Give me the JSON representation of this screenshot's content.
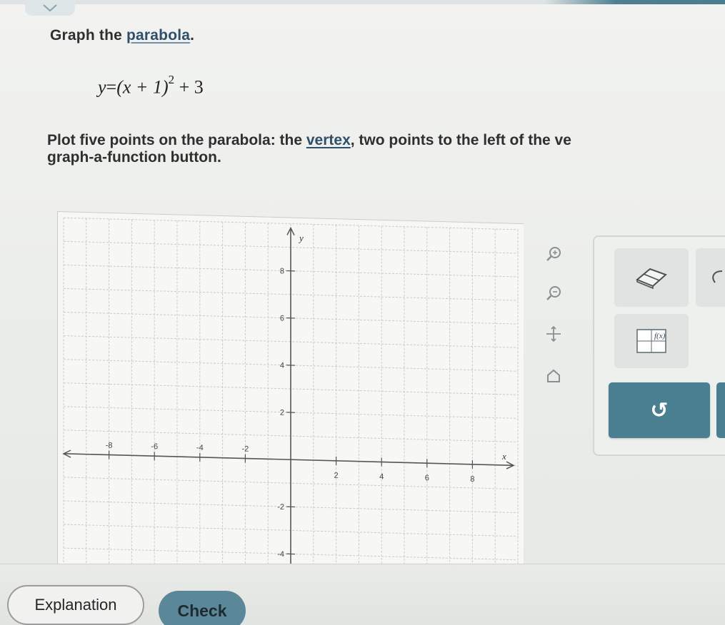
{
  "prompt": {
    "title_prefix": "Graph the ",
    "title_link": "parabola",
    "title_suffix": ".",
    "equation_lhs": "y",
    "equation_eq": "=",
    "equation_inner": "(x + 1)",
    "equation_exp": "2",
    "equation_tail": " + 3",
    "instructions_line1_prefix": "Plot five points on the parabola: the ",
    "instructions_line1_link": "vertex",
    "instructions_line1_suffix": ", two points to the left of the ve",
    "instructions_line2": "graph-a-function button."
  },
  "graph": {
    "axis_x_label": "x",
    "axis_y_label": "y",
    "x_tick_labels": [
      "-8",
      "-6",
      "-4",
      "-2",
      "2",
      "4",
      "6",
      "8"
    ],
    "y_tick_labels": [
      "8",
      "6",
      "4",
      "2",
      "-2",
      "-4"
    ],
    "x_range": [
      -10,
      10
    ],
    "y_range": [
      -6,
      10
    ],
    "grid": true,
    "grid_color": "#c9ccc7",
    "axis_color": "#555555"
  },
  "toolbar": {
    "icons": [
      "zoom-in-icon",
      "zoom-out-icon",
      "move-icon",
      "home-icon"
    ]
  },
  "tools": {
    "eraser_icon": "eraser-icon",
    "function_icon": "graph-function-icon",
    "undo_label": "↺"
  },
  "buttons": {
    "explanation": "Explanation",
    "check": "Check"
  },
  "colors": {
    "accent": "#4a7f91",
    "link": "#2f4f6a"
  }
}
